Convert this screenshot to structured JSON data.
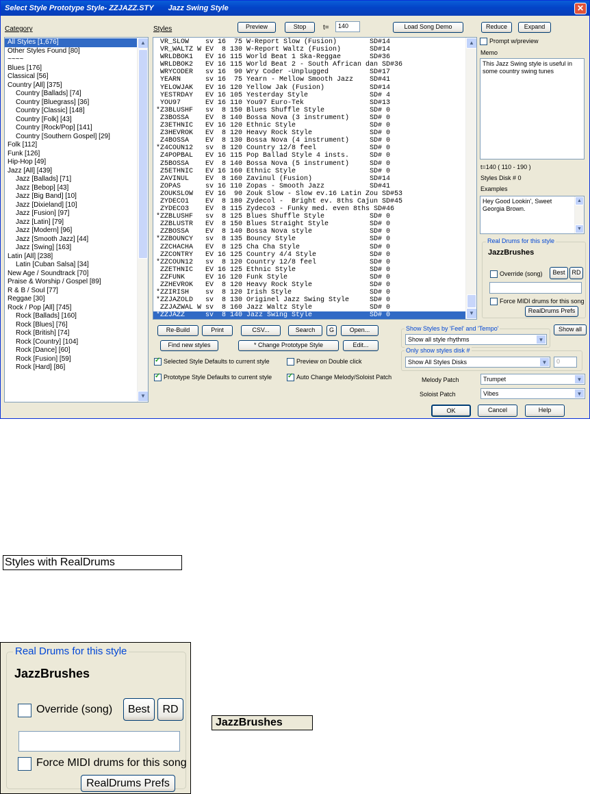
{
  "window": {
    "title": "Select Style Prototype Style- ZZJAZZ.STY",
    "subtitle": "Jazz Swing Style",
    "close": "✕"
  },
  "category": {
    "label": "Category",
    "items": [
      {
        "text": "All Styles [1,676]",
        "sub": false,
        "selected": true
      },
      {
        "text": "Other Styles Found [80]",
        "sub": false
      },
      {
        "text": "~~~~",
        "sub": false
      },
      {
        "text": "Blues [176]",
        "sub": false
      },
      {
        "text": "Classical [56]",
        "sub": false
      },
      {
        "text": "Country [All] [375]",
        "sub": false
      },
      {
        "text": "Country [Ballads] [74]",
        "sub": true
      },
      {
        "text": "Country [Bluegrass] [36]",
        "sub": true
      },
      {
        "text": "Country [Classic] [148]",
        "sub": true
      },
      {
        "text": "Country [Folk] [43]",
        "sub": true
      },
      {
        "text": "Country [Rock/Pop] [141]",
        "sub": true
      },
      {
        "text": "Country [Southern Gospel] [29]",
        "sub": true
      },
      {
        "text": "Folk [112]",
        "sub": false
      },
      {
        "text": "Funk [126]",
        "sub": false
      },
      {
        "text": "Hip-Hop [49]",
        "sub": false
      },
      {
        "text": "Jazz [All] [439]",
        "sub": false
      },
      {
        "text": "Jazz [Ballads] [71]",
        "sub": true
      },
      {
        "text": "Jazz [Bebop] [43]",
        "sub": true
      },
      {
        "text": "Jazz [Big Band] [10]",
        "sub": true
      },
      {
        "text": "Jazz [Dixieland] [10]",
        "sub": true
      },
      {
        "text": "Jazz [Fusion] [97]",
        "sub": true
      },
      {
        "text": "Jazz [Latin] [79]",
        "sub": true
      },
      {
        "text": "Jazz [Modern] [96]",
        "sub": true
      },
      {
        "text": "Jazz [Smooth Jazz] [44]",
        "sub": true
      },
      {
        "text": "Jazz [Swing] [163]",
        "sub": true
      },
      {
        "text": "Latin [All] [238]",
        "sub": false
      },
      {
        "text": "Latin [Cuban Salsa] [34]",
        "sub": true
      },
      {
        "text": "New Age / Soundtrack [70]",
        "sub": false
      },
      {
        "text": "Praise & Worship / Gospel [89]",
        "sub": false
      },
      {
        "text": "R & B / Soul [77]",
        "sub": false
      },
      {
        "text": "Reggae [30]",
        "sub": false
      },
      {
        "text": "Rock / Pop [All] [745]",
        "sub": false
      },
      {
        "text": "Rock [Ballads] [160]",
        "sub": true
      },
      {
        "text": "Rock [Blues] [76]",
        "sub": true
      },
      {
        "text": "Rock [British] [74]",
        "sub": true
      },
      {
        "text": "Rock [Country] [104]",
        "sub": true
      },
      {
        "text": "Rock [Dance] [60]",
        "sub": true
      },
      {
        "text": "Rock [Fusion] [59]",
        "sub": true
      },
      {
        "text": "Rock [Hard] [86]",
        "sub": true
      }
    ]
  },
  "styles": {
    "label": "Styles",
    "preview": "Preview",
    "stop": "Stop",
    "tempo_label": "t=",
    "tempo_value": "140",
    "load_demo": "Load Song Demo",
    "rows": [
      {
        "text": " VR_SLOW    sv 16  75 W-Report Slow (Fusion)        SD#14",
        "selected": false
      },
      {
        "text": " VR_WALTZ W EV  8 130 W-Report Waltz (Fusion)       SD#14",
        "selected": false
      },
      {
        "text": " WRLDBOK1   EV 16 115 World Beat 1 Ska-Reggae       SD#36",
        "selected": false
      },
      {
        "text": " WRLDBOK2   EV 16 115 World Beat 2 - South African dan SD#36",
        "selected": false
      },
      {
        "text": " WRYCODER   sv 16  90 Wry Coder -Unplugged          SD#17",
        "selected": false
      },
      {
        "text": " YEARN      sv 16  75 Yearn - Mellow Smooth Jazz    SD#41",
        "selected": false
      },
      {
        "text": " YELOWJAK   EV 16 120 Yellow Jak (Fusion)           SD#14",
        "selected": false
      },
      {
        "text": " YESTRDAY   EV 16 105 Yesterday Style               SD# 4",
        "selected": false
      },
      {
        "text": " YOU97      EV 16 110 You97 Euro-Tek                SD#13",
        "selected": false
      },
      {
        "text": "*Z3BLUSHF   sv  8 150 Blues Shuffle Style           SD# 0",
        "selected": false
      },
      {
        "text": " Z3BOSSA    EV  8 140 Bossa Nova (3 instrument)     SD# 0",
        "selected": false
      },
      {
        "text": " Z3ETHNIC   EV 16 120 Ethnic Style                  SD# 0",
        "selected": false
      },
      {
        "text": " Z3HEVROK   EV  8 120 Heavy Rock Style              SD# 0",
        "selected": false
      },
      {
        "text": " Z4BOSSA    EV  8 130 Bossa Nova (4 instrument)     SD# 0",
        "selected": false
      },
      {
        "text": "*Z4COUN12   sv  8 120 Country 12/8 feel             SD# 0",
        "selected": false
      },
      {
        "text": " Z4POPBAL   EV 16 115 Pop Ballad Style 4 insts.     SD# 0",
        "selected": false
      },
      {
        "text": " Z5BOSSA    EV  8 140 Bossa Nova (5 instrument)     SD# 0",
        "selected": false
      },
      {
        "text": " Z5ETHNIC   EV 16 160 Ethnic Style                  SD# 0",
        "selected": false
      },
      {
        "text": " ZAVINUL    EV  8 160 Zavinul (Fusion)              SD#14",
        "selected": false
      },
      {
        "text": " ZOPAS      sv 16 110 Zopas - Smooth Jazz           SD#41",
        "selected": false
      },
      {
        "text": " ZOUKSLOW   EV 16  90 Zouk Slow - Slow ev.16 Latin Zou SD#53",
        "selected": false
      },
      {
        "text": " ZYDECO1    EV  8 180 Zydecol -  Bright ev. 8ths Cajun SD#45",
        "selected": false
      },
      {
        "text": " ZYDECO3    EV  8 115 Zydeco3 - Funky med. even 8ths SD#46",
        "selected": false
      },
      {
        "text": "*ZZBLUSHF   sv  8 125 Blues Shuffle Style           SD# 0",
        "selected": false
      },
      {
        "text": " ZZBLUSTR   EV  8 150 Blues Straight Style          SD# 0",
        "selected": false
      },
      {
        "text": " ZZBOSSA    EV  8 140 Bossa Nova style              SD# 0",
        "selected": false
      },
      {
        "text": "*ZZBOUNCY   sv  8 135 Bouncy Style                  SD# 0",
        "selected": false
      },
      {
        "text": " ZZCHACHA   EV  8 125 Cha Cha Style                 SD# 0",
        "selected": false
      },
      {
        "text": " ZZCONTRY   EV 16 125 Country 4/4 Style             SD# 0",
        "selected": false
      },
      {
        "text": "*ZZCOUN12   sv  8 120 Country 12/8 feel             SD# 0",
        "selected": false
      },
      {
        "text": " ZZETHNIC   EV 16 125 Ethnic Style                  SD# 0",
        "selected": false
      },
      {
        "text": " ZZFUNK     EV 16 120 Funk Style                    SD# 0",
        "selected": false
      },
      {
        "text": " ZZHEVROK   EV  8 120 Heavy Rock Style              SD# 0",
        "selected": false
      },
      {
        "text": "*ZZIRISH    sv  8 120 Irish Style                   SD# 0",
        "selected": false
      },
      {
        "text": "*ZZJAZOLD   sv  8 130 Originel Jazz Swing Style     SD# 0",
        "selected": false
      },
      {
        "text": " ZZJAZWAL W sv  8 160 Jazz Waltz Style              SD# 0",
        "selected": false
      },
      {
        "text": "*ZZJAZZ     sv  8 140 Jazz Swing Style              SD# 0",
        "selected": true
      }
    ],
    "buttons": {
      "rebuild": "Re-Build",
      "print": "Print",
      "csv": "CSV...",
      "search": "Search",
      "g": "G",
      "open": "Open...",
      "find_new": "Find new styles",
      "change_proto": "* Change Prototype Style",
      "edit": "Edit..."
    },
    "checks": {
      "selected_defaults": {
        "label": "Selected Style Defaults to current style",
        "checked": true
      },
      "preview_double": {
        "label": "Preview on Double click",
        "checked": false
      },
      "proto_defaults": {
        "label": "Prototype Style Defaults to current style",
        "checked": true
      },
      "auto_change": {
        "label": "Auto Change Melody/Soloist Patch",
        "checked": true
      }
    }
  },
  "right": {
    "reduce": "Reduce",
    "expand": "Expand",
    "prompt_preview": "Prompt w/preview",
    "memo_label": "Memo",
    "memo_text": "This Jazz Swing style is useful in some country swing tunes",
    "tempo_range": "t=140 ( 110 - 190 )",
    "styles_disk": "Styles Disk # 0",
    "examples_label": "Examples",
    "examples_text": "Hey Good Lookin', Sweet Georgia Brown.",
    "realdrums_title": "Real Drums for this style",
    "realdrums_name": "JazzBrushes",
    "override": "Override (song)",
    "best": "Best",
    "rd": "RD",
    "force_midi": "Force MIDI drums for this song",
    "rd_prefs": "RealDrums Prefs",
    "show_all": "Show all"
  },
  "filters": {
    "feel_title": "Show Styles by 'Feel' and 'Tempo'",
    "feel_value": "Show all style rhythms",
    "disk_title": "Only show styles disk #",
    "disk_value": "Show All Styles Disks",
    "disk_num": "0",
    "melody_label": "Melody Patch",
    "melody_value": "Trumpet",
    "soloist_label": "Soloist Patch",
    "soloist_value": "Vibes",
    "ok": "OK",
    "cancel": "Cancel",
    "help": "Help"
  },
  "callouts": {
    "styles_realdrums": "Styles with RealDrums",
    "jazzbrushes_tag": "JazzBrushes"
  },
  "icons": {
    "up": "▲",
    "down": "▼",
    "dropdown": "▼"
  },
  "colors": {
    "selection": "#316ac5",
    "titlebar": "#0a5ed8",
    "face": "#ece9d8"
  }
}
